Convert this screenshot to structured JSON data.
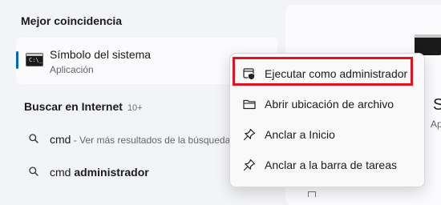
{
  "left_panel": {
    "best_match_heading": "Mejor coincidencia",
    "best_match": {
      "title": "Símbolo del sistema",
      "subtitle": "Aplicación",
      "icon": "command-prompt-icon"
    },
    "web_heading": "Buscar en Internet",
    "web_count": "10+",
    "results": [
      {
        "term": "cmd",
        "hint": " - Ver más resultados de la búsqueda"
      },
      {
        "term": "cmd ",
        "bold": "administrador"
      }
    ]
  },
  "preview": {
    "title": "Sí",
    "subtitle": "Ap"
  },
  "context_menu": {
    "items": [
      {
        "label": "Ejecutar como administrador",
        "icon": "shield-admin-icon"
      },
      {
        "label": "Abrir ubicación de archivo",
        "icon": "folder-icon"
      },
      {
        "label": "Anclar a Inicio",
        "icon": "pin-icon"
      },
      {
        "label": "Anclar a la barra de tareas",
        "icon": "pin-icon"
      }
    ],
    "highlight_color": "#e3121f"
  },
  "colors": {
    "accent": "#0067c0",
    "background": "#f3f4f8"
  }
}
